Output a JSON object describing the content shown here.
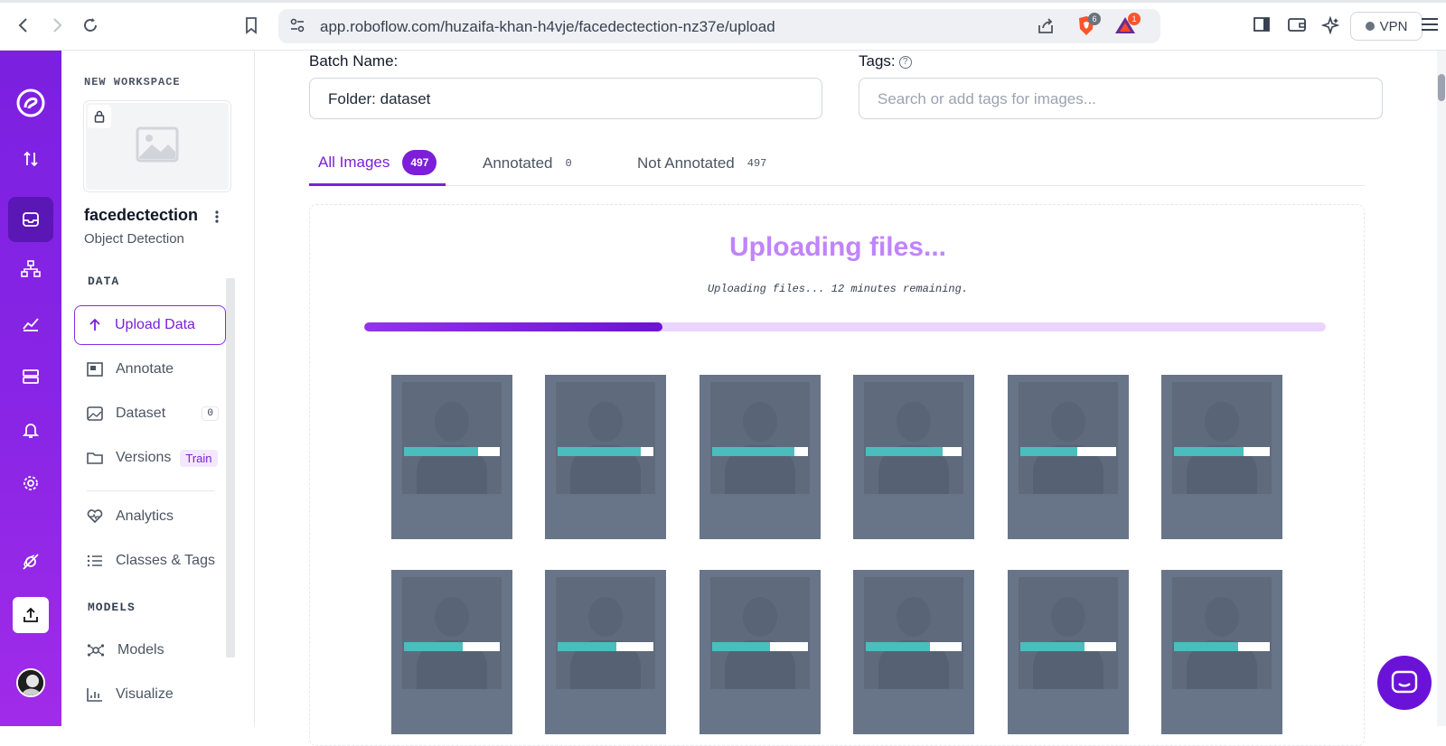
{
  "browser": {
    "url": "app.roboflow.com/huzaifa-khan-h4vje/facedectection-nz37e/upload",
    "brave_badge": "6",
    "rewards_badge": "1",
    "vpn_label": "VPN"
  },
  "workspace": {
    "label": "NEW WORKSPACE",
    "project_name": "facedectection",
    "project_type": "Object Detection"
  },
  "sidebar": {
    "data_section": "DATA",
    "models_section": "MODELS",
    "items": [
      {
        "label": "Upload Data"
      },
      {
        "label": "Annotate"
      },
      {
        "label": "Dataset",
        "count": "0"
      },
      {
        "label": "Versions",
        "tag": "Train"
      },
      {
        "label": "Analytics"
      },
      {
        "label": "Classes & Tags"
      },
      {
        "label": "Models"
      },
      {
        "label": "Visualize"
      }
    ]
  },
  "form": {
    "batch_label": "Batch Name:",
    "batch_value": "Folder: dataset",
    "tags_label": "Tags:",
    "tags_placeholder": "Search or add tags for images..."
  },
  "tabs": [
    {
      "label": "All Images",
      "count": "497"
    },
    {
      "label": "Annotated",
      "count": "0"
    },
    {
      "label": "Not Annotated",
      "count": "497"
    }
  ],
  "upload": {
    "title": "Uploading files...",
    "subtitle": "Uploading files... 12 minutes remaining.",
    "progress": 0.31
  },
  "thumbnails": [
    {
      "progress": 0.77
    },
    {
      "progress": 0.86
    },
    {
      "progress": 0.86
    },
    {
      "progress": 0.8
    },
    {
      "progress": 0.6
    },
    {
      "progress": 0.73
    },
    {
      "progress": 0.61
    },
    {
      "progress": 0.61
    },
    {
      "progress": 0.61
    },
    {
      "progress": 0.67
    },
    {
      "progress": 0.67
    },
    {
      "progress": 0.67
    }
  ],
  "colors": {
    "accent": "#7b1fd8",
    "rail": "#8a25e6",
    "progress_fill": "#4bbdbd"
  }
}
